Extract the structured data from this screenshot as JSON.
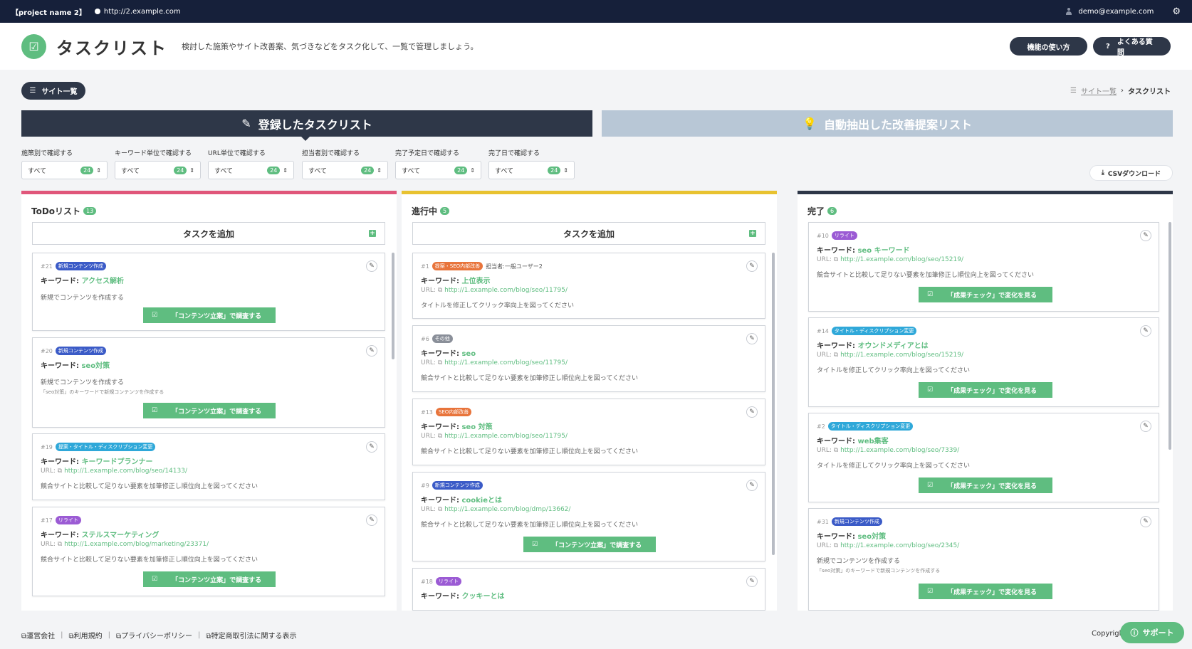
{
  "topbar": {
    "project": "【project name 2】",
    "url": "http://2.example.com",
    "user": "demo@example.com"
  },
  "header": {
    "title": "タスクリスト",
    "description": "検討した施策やサイト改善案、気づきなどをタスク化して、一覧で管理しましょう。",
    "btn_howto": "機能の使い方",
    "btn_faq": "よくある質問"
  },
  "site_button": "サイト一覧",
  "breadcrumb": {
    "link": "サイト一覧",
    "sep": "›",
    "current": "タスクリスト"
  },
  "tabs": {
    "registered": "登録したタスクリスト",
    "auto": "自動抽出した改善提案リスト"
  },
  "filters": [
    {
      "label": "施策別で確認する",
      "value": "すべて",
      "count": "24"
    },
    {
      "label": "キーワード単位で確認する",
      "value": "すべて",
      "count": "24"
    },
    {
      "label": "URL単位で確認する",
      "value": "すべて",
      "count": "24"
    },
    {
      "label": "担当者別で確認する",
      "value": "すべて",
      "count": "24"
    },
    {
      "label": "完了予定日で確認する",
      "value": "すべて",
      "count": "24"
    },
    {
      "label": "完了日で確認する",
      "value": "すべて",
      "count": "24"
    }
  ],
  "csv": "CSVダウンロード",
  "columns": {
    "todo": {
      "title": "ToDoリスト",
      "count": "13",
      "add": "タスクを追加",
      "color": "#e0567a"
    },
    "doing": {
      "title": "進行中",
      "count": "5",
      "add": "タスクを追加",
      "color": "#e8c230"
    },
    "done": {
      "title": "完了",
      "count": "6",
      "color": "#2e3748"
    }
  },
  "labels": {
    "keyword": "キーワード:",
    "url": "URL:",
    "assignee": "担当者:"
  },
  "actions": {
    "research": "「コンテンツ立案」で調査する",
    "check": "「成果チェック」で変化を見る"
  },
  "todo_cards": [
    {
      "num": "#21",
      "tag": "新規コンテンツ作成",
      "kw": "アクセス解析",
      "desc": "新規でコンテンツを作成する"
    },
    {
      "num": "#20",
      "tag": "新規コンテンツ作成",
      "kw": "seo対策",
      "desc": "新規でコンテンツを作成する",
      "sub": "「seo対策」のキーワードで新規コンテンツを作成する"
    },
    {
      "num": "#19",
      "tag": "提案・タイトル・ディスクリプション変更",
      "kw": "キーワードプランナー",
      "url": "http://1.example.com/blog/seo/14133/",
      "desc": "競合サイトと比較して足りない要素を加筆修正し順位向上を図ってください"
    },
    {
      "num": "#17",
      "tag": "リライト",
      "kw": "ステルスマーケティング",
      "url": "http://1.example.com/blog/marketing/23371/",
      "desc": "競合サイトと比較して足りない要素を加筆修正し順位向上を図ってください"
    }
  ],
  "doing_cards": [
    {
      "num": "#1",
      "tag": "提案・SEO内部改善",
      "assignee": "一般ユーザー2",
      "kw": "上位表示",
      "url": "http://1.example.com/blog/seo/11795/",
      "desc": "タイトルを修正してクリック率向上を図ってください"
    },
    {
      "num": "#6",
      "tag": "その他",
      "kw": "seo",
      "url": "http://1.example.com/blog/seo/11795/",
      "desc": "競合サイトと比較して足りない要素を加筆修正し順位向上を図ってください"
    },
    {
      "num": "#13",
      "tag": "SEO内部改善",
      "kw": "seo 対策",
      "url": "http://1.example.com/blog/seo/11795/",
      "desc": "競合サイトと比較して足りない要素を加筆修正し順位向上を図ってください"
    },
    {
      "num": "#9",
      "tag": "新規コンテンツ作成",
      "kw": "cookieとは",
      "url": "http://1.example.com/blog/dmp/13662/",
      "desc": "競合サイトと比較して足りない要素を加筆修正し順位向上を図ってください"
    },
    {
      "num": "#18",
      "tag": "リライト",
      "kw": "クッキーとは"
    }
  ],
  "done_cards": [
    {
      "num": "#10",
      "tag": "リライト",
      "kw": "seo キーワード",
      "url": "http://1.example.com/blog/seo/15219/",
      "desc": "競合サイトと比較して足りない要素を加筆修正し順位向上を図ってください"
    },
    {
      "num": "#14",
      "tag": "タイトル・ディスクリプション変更",
      "kw": "オウンドメディアとは",
      "url": "http://1.example.com/blog/seo/15219/",
      "desc": "タイトルを修正してクリック率向上を図ってください"
    },
    {
      "num": "#2",
      "tag": "タイトル・ディスクリプション変更",
      "kw": "web集客",
      "url": "http://1.example.com/blog/seo/7339/",
      "desc": "タイトルを修正してクリック率向上を図ってください"
    },
    {
      "num": "#31",
      "tag": "新規コンテンツ作成",
      "kw": "seo対策",
      "url": "http://1.example.com/blog/seo/2345/",
      "desc": "新規でコンテンツを作成する",
      "sub": "「seo対策」のキーワードで新規コンテンツを作成する"
    }
  ],
  "tag_colors": {
    "new": "#3b5bc7",
    "proposal": "#e8743b",
    "other": "#8a8f99",
    "rewrite": "#9b5bd4",
    "title": "#2fa8d9",
    "seo": "#e8743b"
  },
  "footer": {
    "links": [
      "運営会社",
      "利用規約",
      "プライバシーポリシー",
      "特定商取引法に関する表示"
    ],
    "copyright": "Copyright"
  },
  "support": "サポート"
}
